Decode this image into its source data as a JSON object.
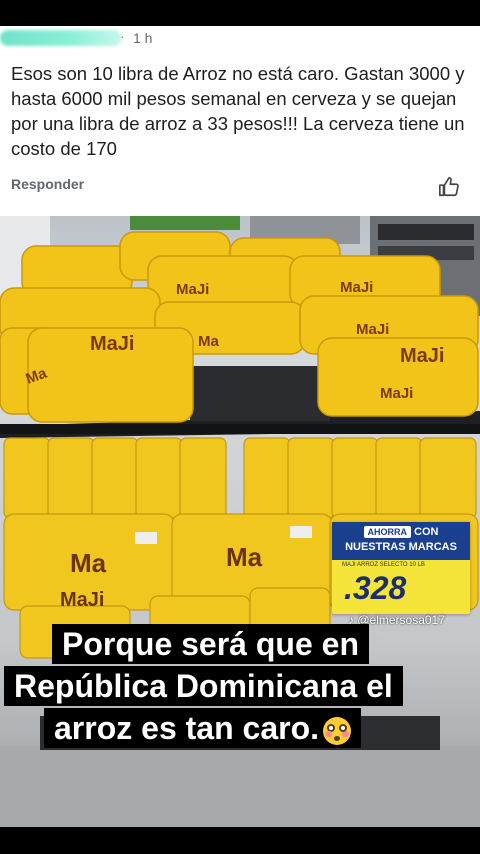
{
  "comment": {
    "time": "1 h",
    "text": "Esos son 10 libra de Arroz  no está caro. Gastan 3000 y hasta 6000 mil pesos semanal en cerveza y se quejan por una libra de arroz a 33 pesos!!!  La cerveza tiene un  costo de 170",
    "reply_label": "Responder",
    "like_icon": "thumbs-up-icon"
  },
  "photo": {
    "bag_brand": "Ma-ji",
    "price_tag": {
      "pill": "AHORRA",
      "pill_rest": "CON",
      "line2": "NUESTRAS MARCAS",
      "small": "MAJI ARROZ SELECTO 10 LB",
      "price": ".328"
    },
    "watermark": "♪ @elmersosa017",
    "caption": [
      "Porque será que en",
      "República Dominicana el",
      "arroz es tan caro."
    ],
    "caption_emoji": "flushed-face-icon",
    "colors": {
      "bag": "#f2c318",
      "tag": "#f5e53a",
      "tag_header": "#1b3f8f"
    }
  }
}
